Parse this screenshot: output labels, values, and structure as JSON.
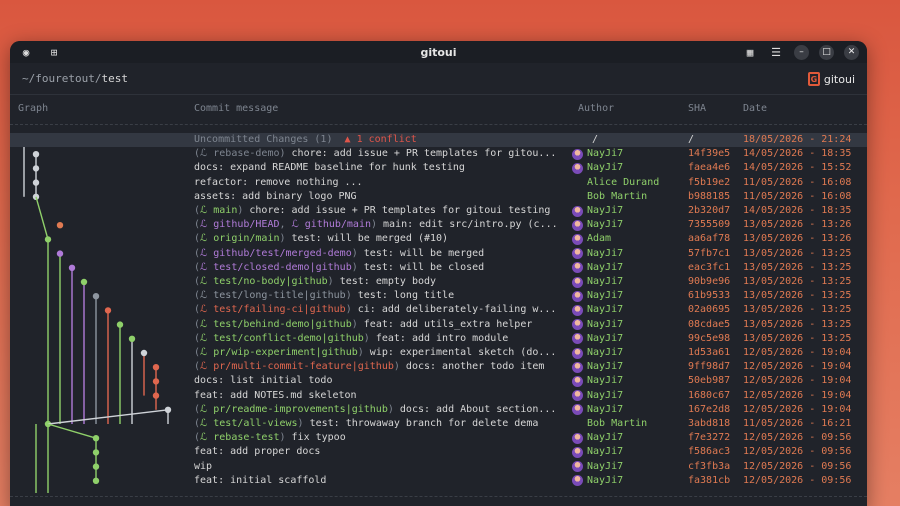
{
  "window": {
    "title": "gitoui"
  },
  "path": {
    "prefix": "~/fouretout/",
    "current": "test"
  },
  "logo": {
    "mark": "G",
    "text": "gitoui"
  },
  "columns": {
    "graph": "Graph",
    "message": "Commit message",
    "author": "Author",
    "sha": "SHA",
    "date": "Date"
  },
  "uncommitted": {
    "label": "Uncommitted Changes (1)",
    "conflict": "1 conflict",
    "author": "/",
    "sha": "/",
    "date": "18/05/2026 - 21:24"
  },
  "commits": [
    {
      "refs": [
        {
          "t": "rebase-demo",
          "c": "muted"
        }
      ],
      "msg": "chore: add issue + PR templates for gitou...",
      "author": "NayJi7",
      "avatar": true,
      "sha": "14f39e5",
      "date": "14/05/2026 - 18:35"
    },
    {
      "refs": [],
      "msg": "docs: expand README baseline for hunk testing",
      "author": "NayJi7",
      "avatar": true,
      "sha": "faea4e6",
      "date": "14/05/2026 - 15:52"
    },
    {
      "refs": [],
      "msg": "refactor: remove nothing ...",
      "author": "Alice Durand",
      "avatar": false,
      "sha": "f5b19e2",
      "date": "11/05/2026 - 16:08"
    },
    {
      "refs": [],
      "msg": "assets: add binary logo PNG",
      "author": "Bob Martin",
      "avatar": false,
      "sha": "b988185",
      "date": "11/05/2026 - 16:08"
    },
    {
      "refs": [
        {
          "t": "main",
          "c": "green"
        }
      ],
      "msg": "chore: add issue + PR templates for gitoui testing",
      "author": "NayJi7",
      "avatar": true,
      "sha": "2b320d7",
      "date": "14/05/2026 - 18:35"
    },
    {
      "refs": [
        {
          "t": "github/HEAD",
          "c": "ref-purple"
        },
        {
          "t": "github/main",
          "c": "ref-purple"
        }
      ],
      "msg": "main: edit src/intro.py (c...",
      "author": "NayJi7",
      "avatar": true,
      "sha": "7355509",
      "date": "13/05/2026 - 13:26"
    },
    {
      "refs": [
        {
          "t": "origin/main",
          "c": "green"
        }
      ],
      "msg": "test: will be merged (#10)",
      "author": "Adam",
      "avatar": true,
      "sha": "aa6af78",
      "date": "13/05/2026 - 13:26"
    },
    {
      "refs": [
        {
          "t": "github/test/merged-demo",
          "c": "ref-purple"
        }
      ],
      "msg": "test: will be merged",
      "author": "NayJi7",
      "avatar": true,
      "sha": "57fb7c1",
      "date": "13/05/2026 - 13:25"
    },
    {
      "refs": [
        {
          "t": "test/closed-demo|github",
          "c": "ref-purple"
        }
      ],
      "msg": "test: will be closed",
      "author": "NayJi7",
      "avatar": true,
      "sha": "eac3fc1",
      "date": "13/05/2026 - 13:25"
    },
    {
      "refs": [
        {
          "t": "test/no-body|github",
          "c": "green"
        }
      ],
      "msg": "test: empty body",
      "author": "NayJi7",
      "avatar": true,
      "sha": "90b9e96",
      "date": "13/05/2026 - 13:25"
    },
    {
      "refs": [
        {
          "t": "test/long-title|github",
          "c": "ref-muted"
        }
      ],
      "msg": "test: long title",
      "author": "NayJi7",
      "avatar": true,
      "sha": "61b9533",
      "date": "13/05/2026 - 13:25"
    },
    {
      "refs": [
        {
          "t": "test/failing-ci|github",
          "c": "ref-red"
        }
      ],
      "msg": "ci: add deliberately-failing w...",
      "author": "NayJi7",
      "avatar": true,
      "sha": "02a0695",
      "date": "13/05/2026 - 13:25"
    },
    {
      "refs": [
        {
          "t": "test/behind-demo|github",
          "c": "green"
        }
      ],
      "msg": "feat: add utils_extra helper",
      "author": "NayJi7",
      "avatar": true,
      "sha": "08cdae5",
      "date": "13/05/2026 - 13:25"
    },
    {
      "refs": [
        {
          "t": "test/conflict-demo|github",
          "c": "green"
        }
      ],
      "msg": "feat: add intro module",
      "author": "NayJi7",
      "avatar": true,
      "sha": "99c5e98",
      "date": "13/05/2026 - 13:25"
    },
    {
      "refs": [
        {
          "t": "pr/wip-experiment|github",
          "c": "green"
        }
      ],
      "msg": "wip: experimental sketch (do...",
      "author": "NayJi7",
      "avatar": true,
      "sha": "1d53a61",
      "date": "12/05/2026 - 19:04"
    },
    {
      "refs": [
        {
          "t": "pr/multi-commit-feature|github",
          "c": "ref-red"
        }
      ],
      "msg": "docs: another todo item",
      "author": "NayJi7",
      "avatar": true,
      "sha": "9ff98d7",
      "date": "12/05/2026 - 19:04"
    },
    {
      "refs": [],
      "msg": "docs: list initial todo",
      "author": "NayJi7",
      "avatar": true,
      "sha": "50eb987",
      "date": "12/05/2026 - 19:04"
    },
    {
      "refs": [],
      "msg": "feat: add NOTES.md skeleton",
      "author": "NayJi7",
      "avatar": true,
      "sha": "1680c67",
      "date": "12/05/2026 - 19:04"
    },
    {
      "refs": [
        {
          "t": "pr/readme-improvements|github",
          "c": "green"
        }
      ],
      "msg": "docs: add About section...",
      "author": "NayJi7",
      "avatar": true,
      "sha": "167e2d8",
      "date": "12/05/2026 - 19:04"
    },
    {
      "refs": [
        {
          "t": "test/all-views",
          "c": "green"
        }
      ],
      "msg": "test: throwaway branch for delete dema",
      "author": "Bob Martin",
      "avatar": false,
      "sha": "3abd818",
      "date": "11/05/2026 - 16:21"
    },
    {
      "refs": [
        {
          "t": "rebase-test",
          "c": "green"
        }
      ],
      "msg": "fix typoo",
      "author": "NayJi7",
      "avatar": true,
      "sha": "f7e3272",
      "date": "12/05/2026 - 09:56"
    },
    {
      "refs": [],
      "msg": "feat: add proper docs",
      "author": "NayJi7",
      "avatar": true,
      "sha": "f586ac3",
      "date": "12/05/2026 - 09:56"
    },
    {
      "refs": [],
      "msg": "wip",
      "author": "NayJi7",
      "avatar": true,
      "sha": "cf3fb3a",
      "date": "12/05/2026 - 09:56"
    },
    {
      "refs": [],
      "msg": "feat: initial scaffold",
      "author": "NayJi7",
      "avatar": true,
      "sha": "fa381cb",
      "date": "12/05/2026 - 09:56"
    }
  ],
  "colors": {
    "accent": "#e07a52",
    "green": "#8fd06a",
    "purple": "#b07bd8",
    "red": "#e0674f"
  }
}
